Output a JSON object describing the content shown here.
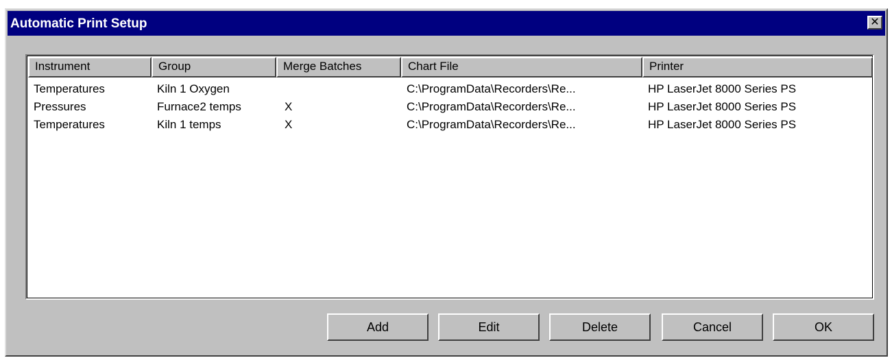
{
  "window": {
    "title": "Automatic Print Setup",
    "close_glyph": "✕"
  },
  "list": {
    "columns": [
      "Instrument",
      "Group",
      "Merge Batches",
      "Chart File",
      "Printer"
    ],
    "rows": [
      {
        "instrument": "Temperatures",
        "group": "Kiln 1 Oxygen",
        "merge": "",
        "chart_file": "C:\\ProgramData\\Recorders\\Re...",
        "printer": "HP LaserJet 8000 Series PS"
      },
      {
        "instrument": "Pressures",
        "group": "Furnace2 temps",
        "merge": "X",
        "chart_file": "C:\\ProgramData\\Recorders\\Re...",
        "printer": "HP LaserJet 8000 Series PS"
      },
      {
        "instrument": "Temperatures",
        "group": "Kiln 1 temps",
        "merge": "X",
        "chart_file": "C:\\ProgramData\\Recorders\\Re...",
        "printer": "HP LaserJet 8000 Series PS"
      }
    ]
  },
  "buttons": {
    "add": "Add",
    "edit": "Edit",
    "delete": "Delete",
    "cancel": "Cancel",
    "ok": "OK"
  },
  "colors": {
    "titlebar": "#000080",
    "face": "#c0c0c0"
  }
}
